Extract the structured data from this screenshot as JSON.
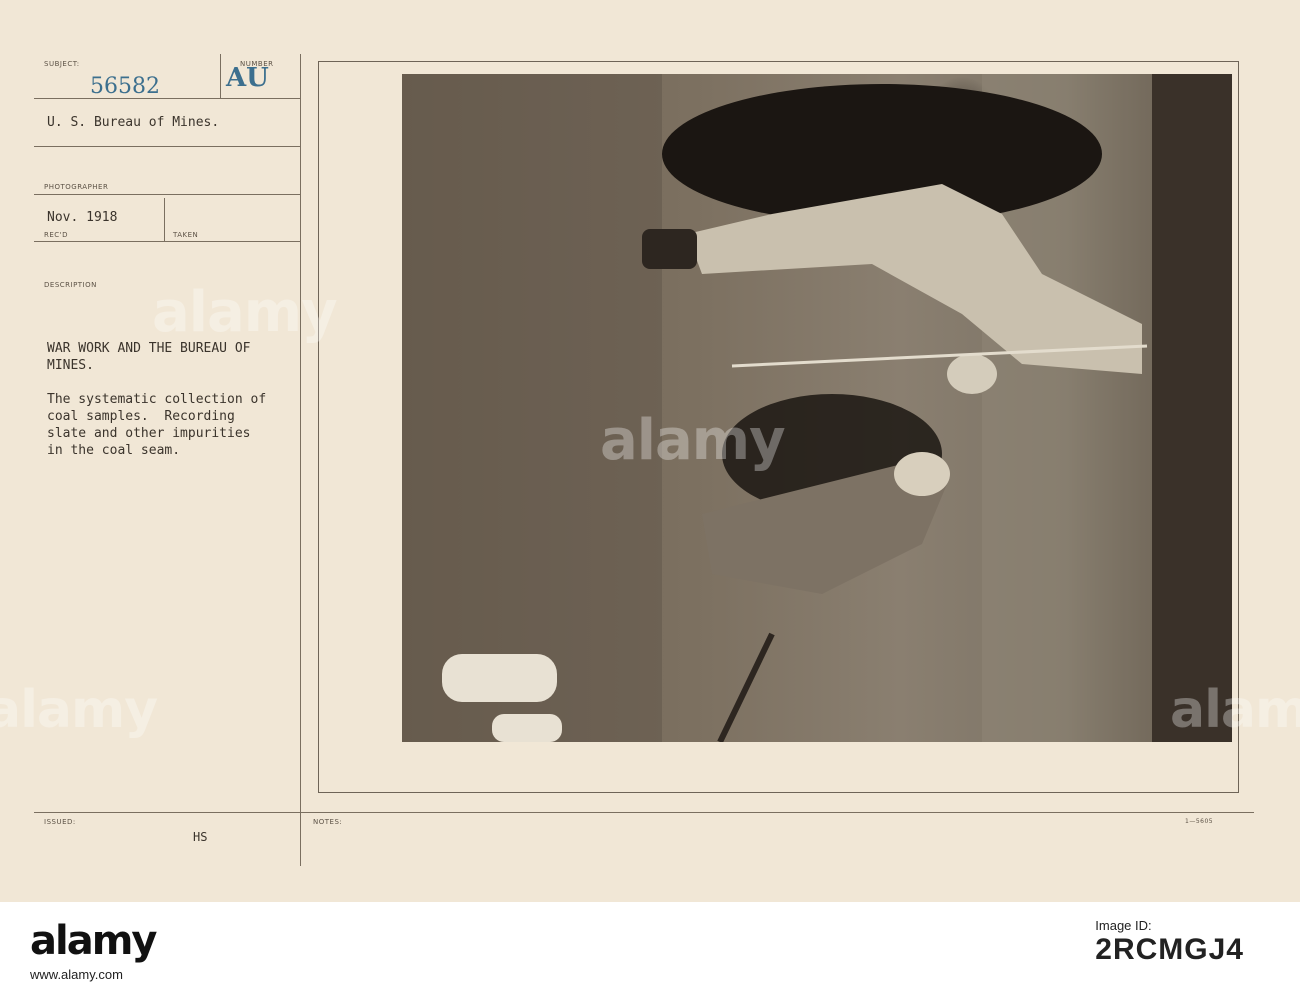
{
  "card": {
    "labels": {
      "subject": "SUBJECT:",
      "number": "NUMBER",
      "photographer": "PHOTOGRAPHER",
      "recd": "REC'D",
      "taken": "TAKEN",
      "description": "DESCRIPTION",
      "issued": "ISSUED:",
      "notes": "NOTES:"
    },
    "subject_number": "56582",
    "number_code": "AU",
    "agency": "U. S. Bureau of Mines.",
    "date": "Nov. 1918",
    "description": {
      "title_line1": "WAR WORK AND THE BUREAU OF",
      "title_line2": "MINES.",
      "body_line1": "The systematic collection of",
      "body_line2": "coal samples.  Recording",
      "body_line3": "slate and other impurities",
      "body_line4": "in the coal seam."
    },
    "issued_initials": "HS",
    "form_code": "1—5605"
  },
  "watermarks": [
    "alamy",
    "alamy",
    "alamy",
    "alamy"
  ],
  "footer": {
    "brand": "alamy",
    "id_label": "Image ID:",
    "id_value": "2RCMGJ4",
    "url": "www.alamy.com"
  }
}
